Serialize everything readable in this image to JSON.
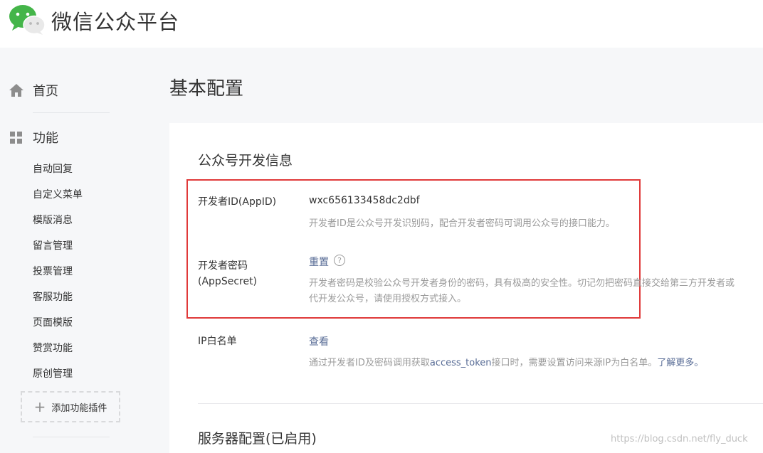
{
  "brand": {
    "title": "微信公众平台",
    "icon": "wechat-logo"
  },
  "sidebar": {
    "home": {
      "label": "首页",
      "icon": "home-icon"
    },
    "functions": {
      "label": "功能",
      "icon": "grid-icon",
      "items": [
        "自动回复",
        "自定义菜单",
        "模版消息",
        "留言管理",
        "投票管理",
        "客服功能",
        "页面模版",
        "赞赏功能",
        "原创管理"
      ]
    },
    "add_plugin": "添加功能插件"
  },
  "main": {
    "page_title": "基本配置",
    "dev_info": {
      "title": "公众号开发信息",
      "appid_label": "开发者ID(AppID)",
      "appid_value": "wxc656133458dc2dbf",
      "appid_tip": "开发者ID是公众号开发识别码，配合开发者密码可调用公众号的接口能力。",
      "secret_label_line1": "开发者密码",
      "secret_label_line2": "(AppSecret)",
      "secret_action": "重置",
      "secret_tip_line1": "开发者密码是校验公众号开发者身份的密码，具有极高的安全性。切记勿把密码直接交给第三方开发者或",
      "secret_tip_line2": "代开发公众号，请使用授权方式接入。",
      "ip_label": "IP白名单",
      "ip_action": "查看",
      "ip_tip_prefix": "通过开发者ID及密码调用获取",
      "ip_tip_token": "access_token",
      "ip_tip_suffix": "接口时，需要设置访问来源IP为白名单。",
      "ip_tip_link": "了解更多。"
    },
    "server_config": {
      "title": "服务器配置(已启用)"
    }
  },
  "watermark": "https://blog.csdn.net/fly_duck",
  "colors": {
    "accent_link": "#576b95",
    "highlight_box": "#e03a3a",
    "wechat_green": "#44b549"
  }
}
